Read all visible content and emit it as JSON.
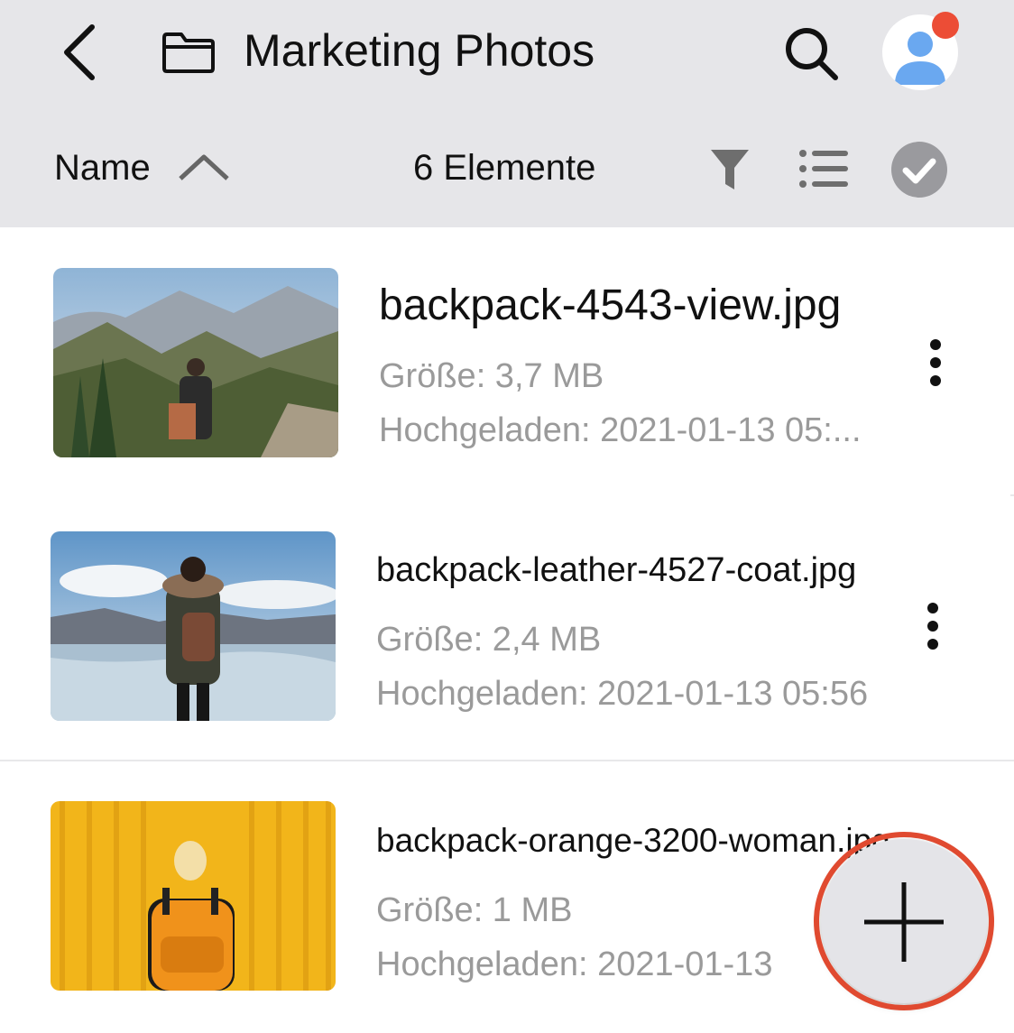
{
  "header": {
    "title": "Marketing Photos"
  },
  "toolbar": {
    "sort_label": "Name",
    "item_count": "6 Elemente"
  },
  "files": [
    {
      "name": "backpack-4543-view.jpg",
      "size": "Größe: 3,7 MB",
      "uploaded": "Hochgeladen: 2021-01-13 05:..."
    },
    {
      "name": "backpack-leather-4527-coat.jpg",
      "size": "Größe: 2,4 MB",
      "uploaded": "Hochgeladen: 2021-01-13 05:56"
    },
    {
      "name": "backpack-orange-3200-woman.jpg",
      "size": "Größe: 1 MB",
      "uploaded": "Hochgeladen: 2021-01-13"
    }
  ],
  "colors": {
    "header_bg": "#e6e6e9",
    "notification_dot": "#ec4d36",
    "avatar_blue": "#6aa8f0",
    "fab_ring": "#e04a30",
    "meta_text": "#9a9a9a"
  },
  "icons": {
    "back": "chevron-left-icon",
    "folder": "folder-icon",
    "search": "search-icon",
    "avatar": "user-avatar-icon",
    "sort": "chevron-up-icon",
    "filter": "filter-icon",
    "view": "list-view-icon",
    "select": "check-circle-icon",
    "more": "more-vertical-icon",
    "add": "plus-icon"
  }
}
